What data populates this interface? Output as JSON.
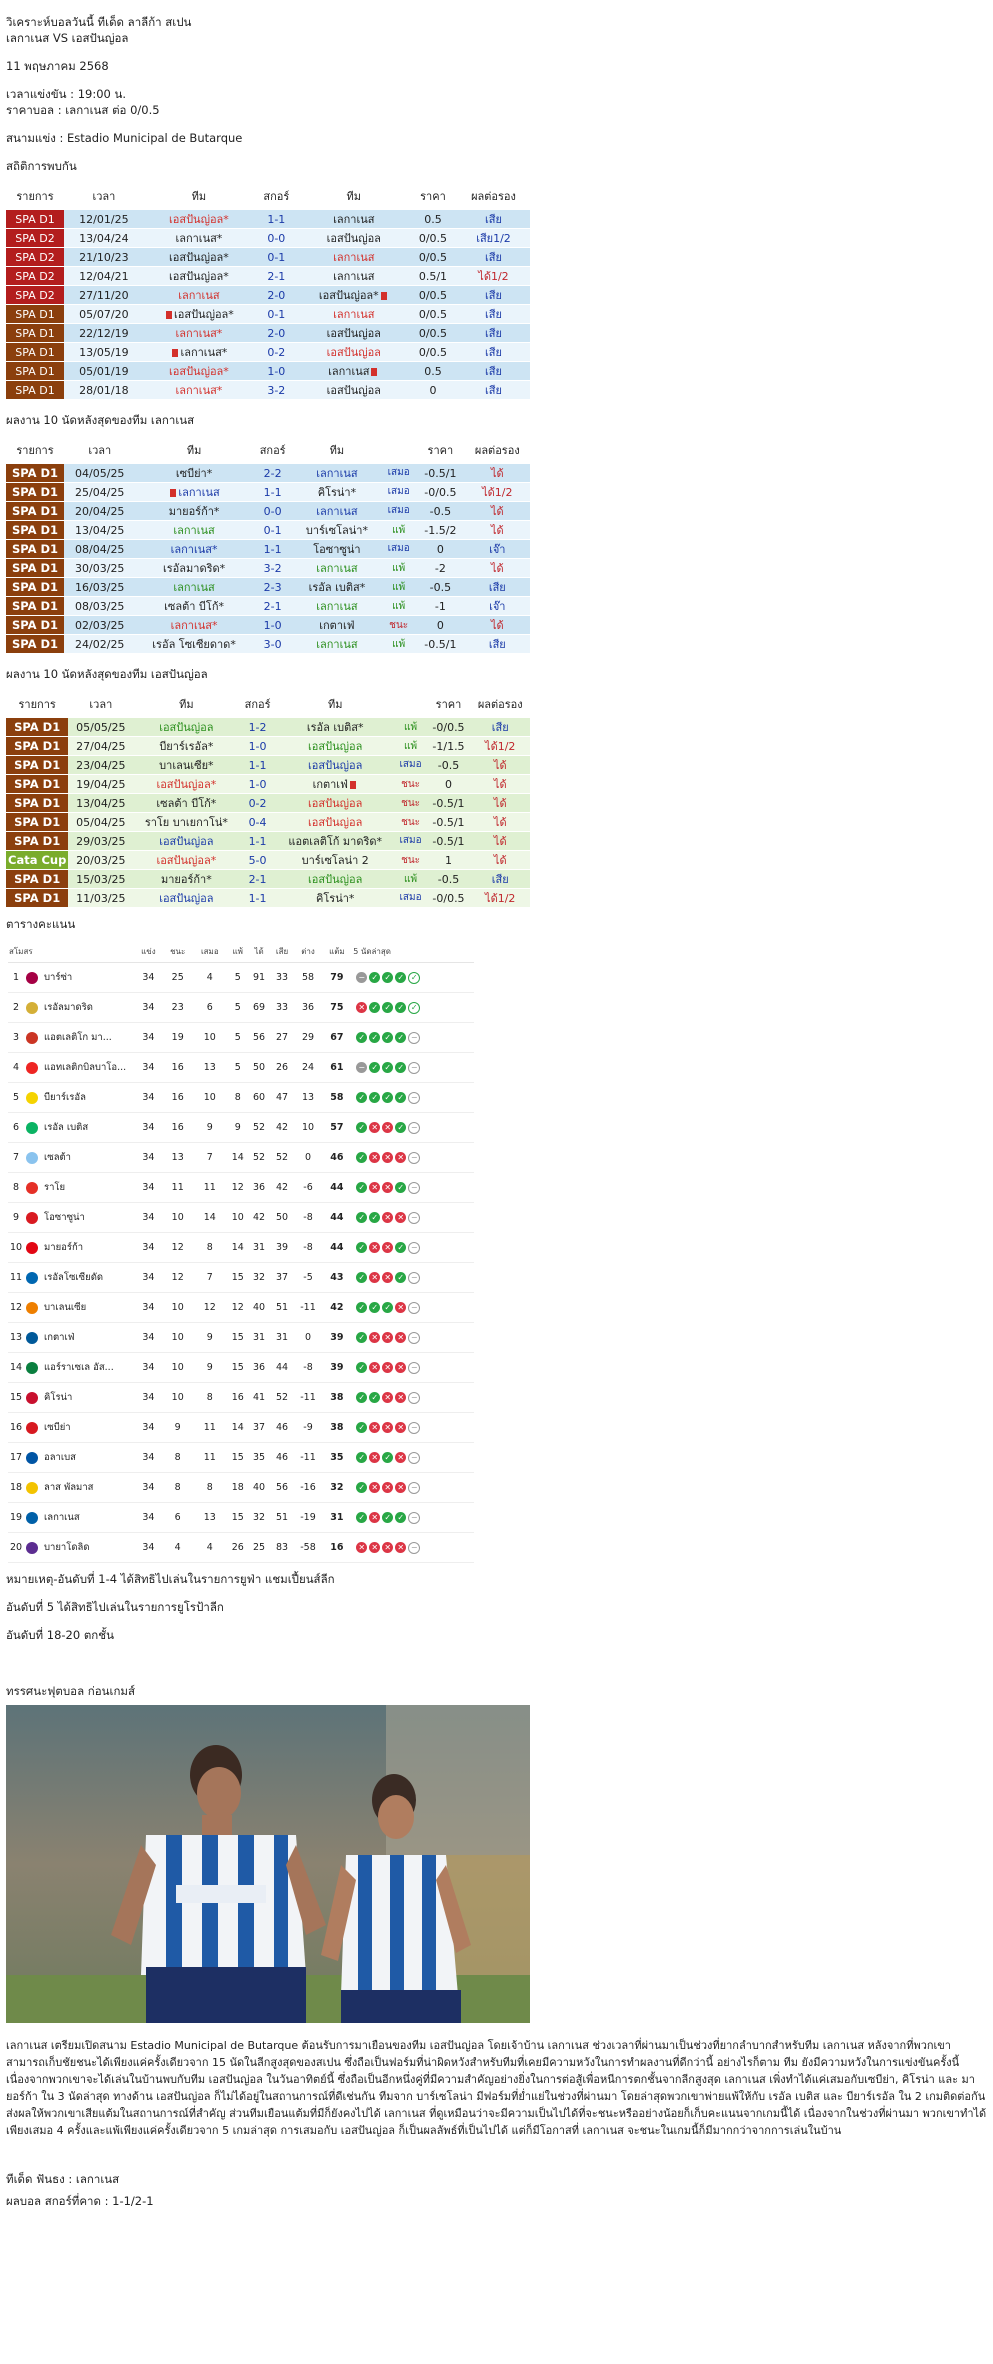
{
  "header": {
    "title": "วิเคราะห์บอลวันนี้ ทีเด็ด ลาลีก้า สเปน",
    "match": "เลกาเนส VS เอสปันญ่อล",
    "date": "11 พฤษภาคม 2568",
    "kickoff": "เวลาแข่งขัน : 19:00  น.",
    "odds": "ราคาบอล : เลกาเนส ต่อ 0/0.5",
    "venue": "สนามแข่ง : Estadio Municipal de Butarque"
  },
  "h2h": {
    "heading": "สถิติการพบกัน",
    "headers": [
      "รายการ",
      "เวลา",
      "ทีม",
      "สกอร์",
      "ทีม",
      "ราคา",
      "ผลต่อรอง"
    ],
    "rows": [
      {
        "league": "SPA D1",
        "date": "12/01/25",
        "home": "เอสปันญ่อล*",
        "home_c": "teamr",
        "score": "1-1",
        "away": "เลกาเนส",
        "away_c": "teamk",
        "odds": "0.5",
        "res": "เสีย",
        "res_c": "bad",
        "lg": "bg-dark",
        "row": "r-blue"
      },
      {
        "league": "SPA D2",
        "date": "13/04/24",
        "home": "เลกาเนส*",
        "home_c": "teamk",
        "score": "0-0",
        "away": "เอสปันญ่อล",
        "away_c": "teamk",
        "odds": "0/0.5",
        "res": "เสีย1/2",
        "res_c": "bad",
        "lg": "bg-dark",
        "row": "r-light"
      },
      {
        "league": "SPA D2",
        "date": "21/10/23",
        "home": "เอสปันญ่อล*",
        "home_c": "teamk",
        "score": "0-1",
        "away": "เลกาเนส",
        "away_c": "teamr",
        "odds": "0/0.5",
        "res": "เสีย",
        "res_c": "bad",
        "lg": "bg-dark",
        "row": "r-blue"
      },
      {
        "league": "SPA D2",
        "date": "12/04/21",
        "home": "เอสปันญ่อล*",
        "home_c": "teamk",
        "score": "2-1",
        "away": "เลกาเนส",
        "away_c": "teamk",
        "odds": "0.5/1",
        "res": "ได้1/2",
        "res_c": "ok",
        "lg": "bg-dark",
        "row": "r-light"
      },
      {
        "league": "SPA D2",
        "date": "27/11/20",
        "home": "เลกาเนส",
        "home_c": "teamr",
        "score": "2-0",
        "away": "เอสปันญ่อล*",
        "away_c": "teamk",
        "odds": "0/0.5",
        "res": "เสีย",
        "res_c": "bad",
        "lg": "bg-dark",
        "row": "r-blue",
        "away_card": true
      },
      {
        "league": "SPA D1",
        "date": "05/07/20",
        "home": "เอสปันญ่อล*",
        "home_c": "teamk",
        "score": "0-1",
        "away": "เลกาเนส",
        "away_c": "teamr",
        "odds": "0/0.5",
        "res": "เสีย",
        "res_c": "bad",
        "lg": "bg-brown",
        "row": "r-light",
        "home_card": true
      },
      {
        "league": "SPA D1",
        "date": "22/12/19",
        "home": "เลกาเนส*",
        "home_c": "teamr",
        "score": "2-0",
        "away": "เอสปันญ่อล",
        "away_c": "teamk",
        "odds": "0/0.5",
        "res": "เสีย",
        "res_c": "bad",
        "lg": "bg-brown",
        "row": "r-blue"
      },
      {
        "league": "SPA D1",
        "date": "13/05/19",
        "home": "เลกาเนส*",
        "home_c": "teamk",
        "score": "0-2",
        "away": "เอสปันญ่อล",
        "away_c": "teamr",
        "odds": "0/0.5",
        "res": "เสีย",
        "res_c": "bad",
        "lg": "bg-brown",
        "row": "r-light",
        "home_card": true
      },
      {
        "league": "SPA D1",
        "date": "05/01/19",
        "home": "เอสปันญ่อล*",
        "home_c": "teamr",
        "score": "1-0",
        "away": "เลกาเนส",
        "away_c": "teamk",
        "odds": "0.5",
        "res": "เสีย",
        "res_c": "bad",
        "lg": "bg-brown",
        "row": "r-blue",
        "away_card": true
      },
      {
        "league": "SPA D1",
        "date": "28/01/18",
        "home": "เลกาเนส*",
        "home_c": "teamr",
        "score": "3-2",
        "away": "เอสปันญ่อล",
        "away_c": "teamk",
        "odds": "0",
        "res": "เสีย",
        "res_c": "bad",
        "lg": "bg-brown",
        "row": "r-light"
      }
    ]
  },
  "form_home": {
    "heading": "ผลงาน 10 นัดหลังสุดของทีม เลกาเนส",
    "headers": [
      "รายการ",
      "เวลา",
      "ทีม",
      "สกอร์",
      "ทีม",
      "",
      "ราคา",
      "ผลต่อรอง"
    ],
    "rows": [
      {
        "league": "SPA D1",
        "date": "04/05/25",
        "home": "เซบีย่า*",
        "home_c": "teamk",
        "score": "2-2",
        "away": "เลกาเนส",
        "away_c": "teamb",
        "st": "เสมอ",
        "st_c": "stB",
        "odds": "-0.5/1",
        "res": "ได้",
        "res_c": "ok",
        "row": "r-blue"
      },
      {
        "league": "SPA D1",
        "date": "25/04/25",
        "home": "เลกาเนส",
        "home_c": "teamb",
        "score": "1-1",
        "away": "คิโรน่า*",
        "away_c": "teamk",
        "st": "เสมอ",
        "st_c": "stB",
        "odds": "-0/0.5",
        "res": "ได้1/2",
        "res_c": "ok",
        "row": "r-light",
        "home_card": true
      },
      {
        "league": "SPA D1",
        "date": "20/04/25",
        "home": "มายอร์ก้า*",
        "home_c": "teamk",
        "score": "0-0",
        "away": "เลกาเนส",
        "away_c": "teamb",
        "st": "เสมอ",
        "st_c": "stB",
        "odds": "-0.5",
        "res": "ได้",
        "res_c": "ok",
        "row": "r-blue"
      },
      {
        "league": "SPA D1",
        "date": "13/04/25",
        "home": "เลกาเนส",
        "home_c": "teamg",
        "score": "0-1",
        "away": "บาร์เซโลน่า*",
        "away_c": "teamk",
        "st": "แพ้",
        "st_c": "stG",
        "odds": "-1.5/2",
        "res": "ได้",
        "res_c": "ok",
        "row": "r-light"
      },
      {
        "league": "SPA D1",
        "date": "08/04/25",
        "home": "เลกาเนส*",
        "home_c": "teamb",
        "score": "1-1",
        "away": "โอซาซูน่า",
        "away_c": "teamk",
        "st": "เสมอ",
        "st_c": "stB",
        "odds": "0",
        "res": "เจ๊า",
        "res_c": "draw",
        "row": "r-blue"
      },
      {
        "league": "SPA D1",
        "date": "30/03/25",
        "home": "เรอัลมาดริด*",
        "home_c": "teamk",
        "score": "3-2",
        "away": "เลกาเนส",
        "away_c": "teamg",
        "st": "แพ้",
        "st_c": "stG",
        "odds": "-2",
        "res": "ได้",
        "res_c": "ok",
        "row": "r-light"
      },
      {
        "league": "SPA D1",
        "date": "16/03/25",
        "home": "เลกาเนส",
        "home_c": "teamg",
        "score": "2-3",
        "away": "เรอัล เบติส*",
        "away_c": "teamk",
        "st": "แพ้",
        "st_c": "stG",
        "odds": "-0.5",
        "res": "เสีย",
        "res_c": "bad",
        "row": "r-blue"
      },
      {
        "league": "SPA D1",
        "date": "08/03/25",
        "home": "เซลต้า บีโก้*",
        "home_c": "teamk",
        "score": "2-1",
        "away": "เลกาเนส",
        "away_c": "teamg",
        "st": "แพ้",
        "st_c": "stG",
        "odds": "-1",
        "res": "เจ๊า",
        "res_c": "draw",
        "row": "r-light"
      },
      {
        "league": "SPA D1",
        "date": "02/03/25",
        "home": "เลกาเนส*",
        "home_c": "teamr",
        "score": "1-0",
        "away": "เกตาเฟ่",
        "away_c": "teamk",
        "st": "ชนะ",
        "st_c": "stR",
        "odds": "0",
        "res": "ได้",
        "res_c": "ok",
        "row": "r-blue"
      },
      {
        "league": "SPA D1",
        "date": "24/02/25",
        "home": "เรอัล โซเซียดาด*",
        "home_c": "teamk",
        "score": "3-0",
        "away": "เลกาเนส",
        "away_c": "teamg",
        "st": "แพ้",
        "st_c": "stG",
        "odds": "-0.5/1",
        "res": "เสีย",
        "res_c": "bad",
        "row": "r-light"
      }
    ]
  },
  "form_away": {
    "heading": "ผลงาน 10 นัดหลังสุดของทีม เอสปันญ่อล",
    "headers": [
      "รายการ",
      "เวลา",
      "ทีม",
      "สกอร์",
      "ทีม",
      "",
      "ราคา",
      "ผลต่อรอง"
    ],
    "rows": [
      {
        "league": "SPA D1",
        "date": "05/05/25",
        "home": "เอสปันญ่อล",
        "home_c": "teamg",
        "score": "1-2",
        "away": "เรอัล เบติส*",
        "away_c": "teamk",
        "st": "แพ้",
        "st_c": "stG",
        "odds": "-0/0.5",
        "res": "เสีย",
        "res_c": "bad",
        "lg": "bg-brown",
        "row": "r-green"
      },
      {
        "league": "SPA D1",
        "date": "27/04/25",
        "home": "บียาร์เรอัล*",
        "home_c": "teamk",
        "score": "1-0",
        "away": "เอสปันญ่อล",
        "away_c": "teamg",
        "st": "แพ้",
        "st_c": "stG",
        "odds": "-1/1.5",
        "res": "ได้1/2",
        "res_c": "ok",
        "lg": "bg-brown",
        "row": "r-lgreen"
      },
      {
        "league": "SPA D1",
        "date": "23/04/25",
        "home": "บาเลนเซีย*",
        "home_c": "teamk",
        "score": "1-1",
        "away": "เอสปันญ่อล",
        "away_c": "teamb",
        "st": "เสมอ",
        "st_c": "stB",
        "odds": "-0.5",
        "res": "ได้",
        "res_c": "ok",
        "lg": "bg-brown",
        "row": "r-green"
      },
      {
        "league": "SPA D1",
        "date": "19/04/25",
        "home": "เอสปันญ่อล*",
        "home_c": "teamr",
        "score": "1-0",
        "away": "เกตาเฟ่",
        "away_c": "teamk",
        "st": "ชนะ",
        "st_c": "stR",
        "odds": "0",
        "res": "ได้",
        "res_c": "ok",
        "lg": "bg-brown",
        "row": "r-lgreen",
        "away_card": true
      },
      {
        "league": "SPA D1",
        "date": "13/04/25",
        "home": "เซลต้า บีโก้*",
        "home_c": "teamk",
        "score": "0-2",
        "away": "เอสปันญ่อล",
        "away_c": "teamr",
        "st": "ชนะ",
        "st_c": "stR",
        "odds": "-0.5/1",
        "res": "ได้",
        "res_c": "ok",
        "lg": "bg-brown",
        "row": "r-green"
      },
      {
        "league": "SPA D1",
        "date": "05/04/25",
        "home": "ราโย บาเยกาโน่*",
        "home_c": "teamk",
        "score": "0-4",
        "away": "เอสปันญ่อล",
        "away_c": "teamr",
        "st": "ชนะ",
        "st_c": "stR",
        "odds": "-0.5/1",
        "res": "ได้",
        "res_c": "ok",
        "lg": "bg-brown",
        "row": "r-lgreen"
      },
      {
        "league": "SPA D1",
        "date": "29/03/25",
        "home": "เอสปันญ่อล",
        "home_c": "teamb",
        "score": "1-1",
        "away": "แอตเลติโก้ มาดริด*",
        "away_c": "teamk",
        "st": "เสมอ",
        "st_c": "stB",
        "odds": "-0.5/1",
        "res": "ได้",
        "res_c": "ok",
        "lg": "bg-brown",
        "row": "r-green"
      },
      {
        "league": "Cata Cup",
        "date": "20/03/25",
        "home": "เอสปันญ่อล*",
        "home_c": "teamr",
        "score": "5-0",
        "away": "บาร์เซโลน่า 2",
        "away_c": "teamk",
        "st": "ชนะ",
        "st_c": "stR",
        "odds": "1",
        "res": "ได้",
        "res_c": "ok",
        "lg": "bg-green",
        "row": "r-lgreen"
      },
      {
        "league": "SPA D1",
        "date": "15/03/25",
        "home": "มายอร์ก้า*",
        "home_c": "teamk",
        "score": "2-1",
        "away": "เอสปันญ่อล",
        "away_c": "teamg",
        "st": "แพ้",
        "st_c": "stG",
        "odds": "-0.5",
        "res": "เสีย",
        "res_c": "bad",
        "lg": "bg-brown",
        "row": "r-green"
      },
      {
        "league": "SPA D1",
        "date": "11/03/25",
        "home": "เอสปันญ่อล",
        "home_c": "teamb",
        "score": "1-1",
        "away": "คิโรน่า*",
        "away_c": "teamk",
        "st": "เสมอ",
        "st_c": "stB",
        "odds": "-0/0.5",
        "res": "ได้1/2",
        "res_c": "ok",
        "lg": "bg-brown",
        "row": "r-lgreen"
      }
    ]
  },
  "standings": {
    "heading": "ตารางคะแนน",
    "headers": [
      "สโมสร",
      "แข่ง",
      "ชนะ",
      "เสมอ",
      "แพ้",
      "ได้",
      "เสีย",
      "ต่าง",
      "แต้ม",
      "5 นัดล่าสุด"
    ],
    "rows": [
      {
        "pos": "1",
        "team": "บาร์ซ่า",
        "color": "#a50044",
        "p": "34",
        "w": "25",
        "d": "4",
        "l": "5",
        "gf": "91",
        "ga": "33",
        "gd": "58",
        "pts": "79",
        "form": "DWWWN"
      },
      {
        "pos": "2",
        "team": "เรอัลมาดริด",
        "color": "#d4af37",
        "p": "34",
        "w": "23",
        "d": "6",
        "l": "5",
        "gf": "69",
        "ga": "33",
        "gd": "36",
        "pts": "75",
        "form": "LWWWN"
      },
      {
        "pos": "3",
        "team": "แอตเลติโก มา...",
        "color": "#cb3524",
        "p": "34",
        "w": "19",
        "d": "10",
        "l": "5",
        "gf": "56",
        "ga": "27",
        "gd": "29",
        "pts": "67",
        "form": "WWWWX"
      },
      {
        "pos": "4",
        "team": "แอทเลติกบิลบาโอ...",
        "color": "#ee2523",
        "p": "34",
        "w": "16",
        "d": "13",
        "l": "5",
        "gf": "50",
        "ga": "26",
        "gd": "24",
        "pts": "61",
        "form": "DWWWX"
      },
      {
        "pos": "5",
        "team": "บียาร์เรอัล",
        "color": "#f5d300",
        "p": "34",
        "w": "16",
        "d": "10",
        "l": "8",
        "gf": "60",
        "ga": "47",
        "gd": "13",
        "pts": "58",
        "form": "WWWWX"
      },
      {
        "pos": "6",
        "team": "เรอัล เบติส",
        "color": "#0bb363",
        "p": "34",
        "w": "16",
        "d": "9",
        "l": "9",
        "gf": "52",
        "ga": "42",
        "gd": "10",
        "pts": "57",
        "form": "WLLWX"
      },
      {
        "pos": "7",
        "team": "เซลต้า",
        "color": "#8ac3ee",
        "p": "34",
        "w": "13",
        "d": "7",
        "l": "14",
        "gf": "52",
        "ga": "52",
        "gd": "0",
        "pts": "46",
        "form": "WLLLX"
      },
      {
        "pos": "8",
        "team": "ราโย",
        "color": "#e53027",
        "p": "34",
        "w": "11",
        "d": "11",
        "l": "12",
        "gf": "36",
        "ga": "42",
        "gd": "-6",
        "pts": "44",
        "form": "WLLWX"
      },
      {
        "pos": "9",
        "team": "โอซาซูน่า",
        "color": "#d91a21",
        "p": "34",
        "w": "10",
        "d": "14",
        "l": "10",
        "gf": "42",
        "ga": "50",
        "gd": "-8",
        "pts": "44",
        "form": "WWLLX"
      },
      {
        "pos": "10",
        "team": "มายอร์ก้า",
        "color": "#e20613",
        "p": "34",
        "w": "12",
        "d": "8",
        "l": "14",
        "gf": "31",
        "ga": "39",
        "gd": "-8",
        "pts": "44",
        "form": "WLLWX"
      },
      {
        "pos": "11",
        "team": "เรอัลโซเซียดัด",
        "color": "#0067b1",
        "p": "34",
        "w": "12",
        "d": "7",
        "l": "15",
        "gf": "32",
        "ga": "37",
        "gd": "-5",
        "pts": "43",
        "form": "WLLWX"
      },
      {
        "pos": "12",
        "team": "บาเลนเซีย",
        "color": "#ee7f00",
        "p": "34",
        "w": "10",
        "d": "12",
        "l": "12",
        "gf": "40",
        "ga": "51",
        "gd": "-11",
        "pts": "42",
        "form": "WWWLX"
      },
      {
        "pos": "13",
        "team": "เกตาเฟ่",
        "color": "#005999",
        "p": "34",
        "w": "10",
        "d": "9",
        "l": "15",
        "gf": "31",
        "ga": "31",
        "gd": "0",
        "pts": "39",
        "form": "WLLLX"
      },
      {
        "pos": "14",
        "team": "แอร์ราเซเล อัส...",
        "color": "#0a7f3f",
        "p": "34",
        "w": "10",
        "d": "9",
        "l": "15",
        "gf": "36",
        "ga": "44",
        "gd": "-8",
        "pts": "39",
        "form": "WLLLX"
      },
      {
        "pos": "15",
        "team": "คิโรน่า",
        "color": "#c8102e",
        "p": "34",
        "w": "10",
        "d": "8",
        "l": "16",
        "gf": "41",
        "ga": "52",
        "gd": "-11",
        "pts": "38",
        "form": "WWLLX"
      },
      {
        "pos": "16",
        "team": "เซบีย่า",
        "color": "#d71920",
        "p": "34",
        "w": "9",
        "d": "11",
        "l": "14",
        "gf": "37",
        "ga": "46",
        "gd": "-9",
        "pts": "38",
        "form": "WLLLX"
      },
      {
        "pos": "17",
        "team": "อลาเบส",
        "color": "#0055a4",
        "p": "34",
        "w": "8",
        "d": "11",
        "l": "15",
        "gf": "35",
        "ga": "46",
        "gd": "-11",
        "pts": "35",
        "form": "WLWLX"
      },
      {
        "pos": "18",
        "team": "ลาส พัลมาส",
        "color": "#f3c300",
        "p": "34",
        "w": "8",
        "d": "8",
        "l": "18",
        "gf": "40",
        "ga": "56",
        "gd": "-16",
        "pts": "32",
        "form": "WLLLX"
      },
      {
        "pos": "19",
        "team": "เลกาเนส",
        "color": "#0060a8",
        "p": "34",
        "w": "6",
        "d": "13",
        "l": "15",
        "gf": "32",
        "ga": "51",
        "gd": "-19",
        "pts": "31",
        "form": "WLWWX"
      },
      {
        "pos": "20",
        "team": "บายาโดลิด",
        "color": "#5c2d91",
        "p": "34",
        "w": "4",
        "d": "4",
        "l": "26",
        "gf": "25",
        "ga": "83",
        "gd": "-58",
        "pts": "16",
        "form": "LLLLX"
      }
    ]
  },
  "notes": {
    "n1": "หมายเหตุ-อันดับที่ 1-4 ได้สิทธิไปเล่นในรายการยูฟ่า แชมเปี้ยนส์ลีก",
    "n2": "อันดับที่ 5 ได้สิทธิไปเล่นในรายการยูโรป้าลีก",
    "n3": "อันดับที่ 18-20 ตกชั้น"
  },
  "preview": {
    "heading": "ทรรศนะฟุตบอล ก่อนเกมส์",
    "paragraph": "เลกาเนส เตรียมเปิดสนาม Estadio Municipal de Butarque ต้อนรับการมาเยือนของทีม เอสปันญ่อล โดยเจ้าบ้าน เลกาเนส ช่วงเวลาที่ผ่านมาเป็นช่วงที่ยากลำบากสำหรับทีม เลกาเนส หลังจากที่พวกเขาสามารถเก็บชัยชนะได้เพียงแค่ครั้งเดียวจาก 15 นัดในลีกสูงสุดของสเปน ซึ่งถือเป็นฟอร์มที่น่าผิดหวังสำหรับทีมที่เคยมีความหวังในการทำผลงานที่ดีกว่านี้ อย่างไรก็ตาม ทีม ยังมีความหวังในการแข่งขันครั้งนี้ เนื่องจากพวกเขาจะได้เล่นในบ้านพบกับทีม เอสปันญ่อล ในวันอาทิตย์นี้ ซึ่งถือเป็นอีกหนึ่งคู่ที่มีความสำคัญอย่างยิ่งในการต่อสู้เพื่อหนีการตกชั้นจากลีกสูงสุด เลกาเนส เพิ่งทำได้แค่เสมอกับเซบีย่า, คิโรน่า และ มายอร์ก้า ใน 3 นัดล่าสุด ทางด้าน เอสปันญ่อล ก็ไม่ได้อยู่ในสถานการณ์ที่ดีเช่นกัน ทีมจาก บาร์เซโลน่า มีฟอร์มที่ย่ำแย่ในช่วงที่ผ่านมา โดยล่าสุดพวกเขาพ่ายแพ้ให้กับ เรอัล เบติส และ บียาร์เรอัล ใน 2 เกมติดต่อกัน ส่งผลให้พวกเขาเสียแต้มในสถานการณ์ที่สำคัญ ส่วนทีมเยือนแต้มที่มีก็ยังคงไปได้ เลกาเนส ที่ดูเหมือนว่าจะมีความเป็นไปได้ที่จะชนะหรืออย่างน้อยก็เก็บคะแนนจากเกมนี้ได้ เนื่องจากในช่วงที่ผ่านมา พวกเขาทำได้เพียงเสมอ 4 ครั้งและแพ้เพียงแค่ครั้งเดียวจาก 5 เกมล่าสุด การเสมอกับ เอสปันญ่อล ก็เป็นผลลัพธ์ที่เป็นไปได้ แต่ก็มีโอกาสที่ เลกาเนส จะชนะในเกมนี้ก็มีมากกว่าจากการเล่นในบ้าน",
    "tip": "ทีเด็ด ฟันธง : เลกาเนส",
    "score": "ผลบอล สกอร์ที่คาด  : 1-1/2-1"
  }
}
